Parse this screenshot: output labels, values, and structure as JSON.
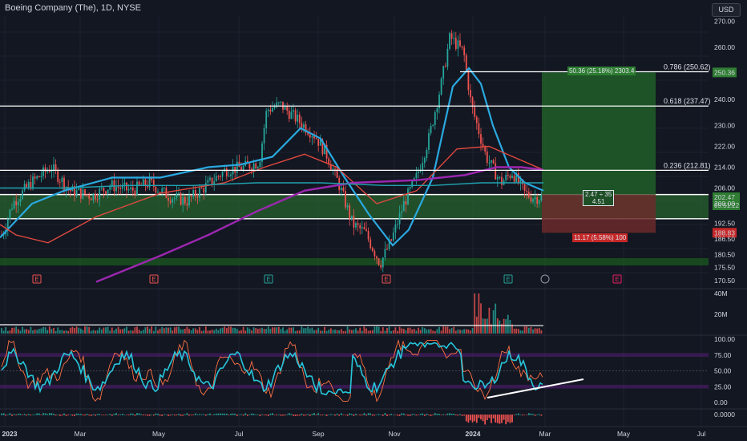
{
  "header": {
    "title": "Boeing Company (The), 1D, NYSE",
    "currency": "USD"
  },
  "colors": {
    "bg": "#131722",
    "up": "#26a69a",
    "down": "#ef5350",
    "ma_blue": "#2aa9e0",
    "ma_red": "#e0493f",
    "ma_purple": "#9c27b0",
    "ma_teal": "#1fa3b0",
    "zone_green": "#2e7d32",
    "target_green": "#1f4f27",
    "stop_red": "#5d1f22",
    "rsi_line": "#26c6da",
    "stoch_line": "#ff7043"
  },
  "price_axis": {
    "ticks": [
      "270.00",
      "260.00",
      "250.36",
      "240.00",
      "230.00",
      "222.00",
      "214.00",
      "206.00",
      "202.47",
      "200.00",
      "192.50",
      "188.83",
      "186.50",
      "180.50",
      "175.50",
      "170.50"
    ]
  },
  "price_tags": {
    "last_price": "202.47",
    "countdown": "05:51:22",
    "target": "250.36",
    "stop": "188.83"
  },
  "fib_levels": [
    {
      "label": "0.786 (250.62)",
      "value": 250.62
    },
    {
      "label": "0.618 (237.47)",
      "value": 237.47
    },
    {
      "label": "0.236 (212.81)",
      "value": 212.81
    }
  ],
  "position_tool": {
    "target_label": "50.36 (25.18%) 2303.4",
    "ratio_line1": "2.47 ÷ 35",
    "ratio_line2": "4.51",
    "stop_label": "11.17 (5.58%) 100"
  },
  "volume_axis": {
    "ticks": [
      "40M",
      "20M"
    ]
  },
  "osc_axis": {
    "ticks": [
      "100.00",
      "75.00",
      "50.00",
      "25.00",
      "0.00"
    ]
  },
  "macd_axis": {
    "ticks": [
      "0.0000"
    ]
  },
  "time_axis": {
    "labels": [
      "2023",
      "Mar",
      "May",
      "Jul",
      "Sep",
      "Nov",
      "2024",
      "Mar",
      "May",
      "Jul"
    ]
  },
  "chart_data": {
    "type": "line",
    "title": "Boeing Company (The), 1D, NYSE",
    "x_unit": "date",
    "x_labels": [
      "2023",
      "Mar",
      "May",
      "Jul",
      "Sep",
      "Nov",
      "2024",
      "Mar",
      "May",
      "Jul"
    ],
    "close_path": [
      [
        "2022-12-28",
        188
      ],
      [
        "2023-01-05",
        200
      ],
      [
        "2023-01-20",
        208
      ],
      [
        "2023-02-05",
        214
      ],
      [
        "2023-02-20",
        205
      ],
      [
        "2023-03-10",
        203
      ],
      [
        "2023-03-25",
        207
      ],
      [
        "2023-04-10",
        205
      ],
      [
        "2023-04-25",
        208
      ],
      [
        "2023-05-10",
        203
      ],
      [
        "2023-05-25",
        201
      ],
      [
        "2023-06-10",
        207
      ],
      [
        "2023-06-25",
        213
      ],
      [
        "2023-07-10",
        214
      ],
      [
        "2023-07-22",
        216
      ],
      [
        "2023-07-28",
        236
      ],
      [
        "2023-08-08",
        238
      ],
      [
        "2023-08-22",
        232
      ],
      [
        "2023-09-05",
        226
      ],
      [
        "2023-09-15",
        218
      ],
      [
        "2023-09-25",
        206
      ],
      [
        "2023-10-05",
        192
      ],
      [
        "2023-10-15",
        189
      ],
      [
        "2023-10-27",
        177
      ],
      [
        "2023-11-05",
        186
      ],
      [
        "2023-11-15",
        200
      ],
      [
        "2023-11-25",
        210
      ],
      [
        "2023-12-05",
        225
      ],
      [
        "2023-12-15",
        246
      ],
      [
        "2023-12-22",
        264
      ],
      [
        "2024-01-02",
        258
      ],
      [
        "2024-01-08",
        238
      ],
      [
        "2024-01-20",
        218
      ],
      [
        "2024-02-01",
        208
      ],
      [
        "2024-02-10",
        212
      ],
      [
        "2024-02-20",
        204
      ],
      [
        "2024-02-26",
        202.47
      ]
    ],
    "y_range": [
      168,
      272
    ],
    "moving_averages": [
      "blue",
      "red",
      "purple",
      "teal"
    ],
    "volume_max_label": "40M",
    "oscillator_range": [
      0,
      100
    ],
    "oscillator_bands": [
      25,
      50,
      75
    ]
  }
}
